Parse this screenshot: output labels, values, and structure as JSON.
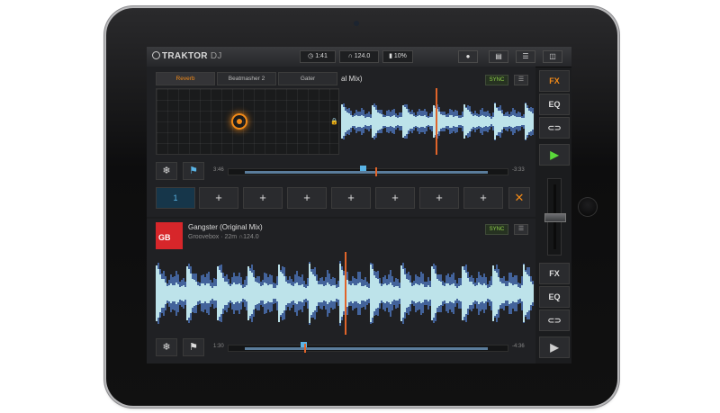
{
  "app": {
    "logo": "TRAKTOR",
    "logo_suffix": "DJ"
  },
  "topbar": {
    "time": "1:41",
    "bpm": "124.0",
    "battery": "10%",
    "clock_icon": "clock-icon",
    "headphones_icon": "headphones-icon",
    "battery_icon": "battery-icon"
  },
  "deck_a": {
    "fx_tabs": [
      "Reverb",
      "Beatmasher 2",
      "Gater"
    ],
    "title_visible": "al Mix)",
    "sync": "SYNC",
    "elapsed": "3:46",
    "remaining": "-3:33",
    "cue_active": "1",
    "cue_add": [
      "+",
      "+",
      "+",
      "+",
      "+",
      "+",
      "+"
    ],
    "cue_delete": "✕"
  },
  "deck_b": {
    "title": "Gangster (Original Mix)",
    "artist": "Groovebox",
    "key": "22m",
    "bpm": "124.0",
    "sync": "SYNC",
    "elapsed": "1:30",
    "remaining": "-4:36",
    "art_label": "GB"
  },
  "side_a": {
    "fx": "FX",
    "eq": "EQ",
    "loop": "⊂⊃",
    "play": "▶"
  },
  "side_b": {
    "fx": "FX",
    "eq": "EQ",
    "loop": "⊂⊃",
    "play": "▶"
  },
  "colors": {
    "accent": "#f28a18",
    "wave_blue": "#4a6fb0",
    "wave_cyan": "#bde3ea",
    "playhead": "#e0642a",
    "sync_green": "#8fd04b"
  }
}
